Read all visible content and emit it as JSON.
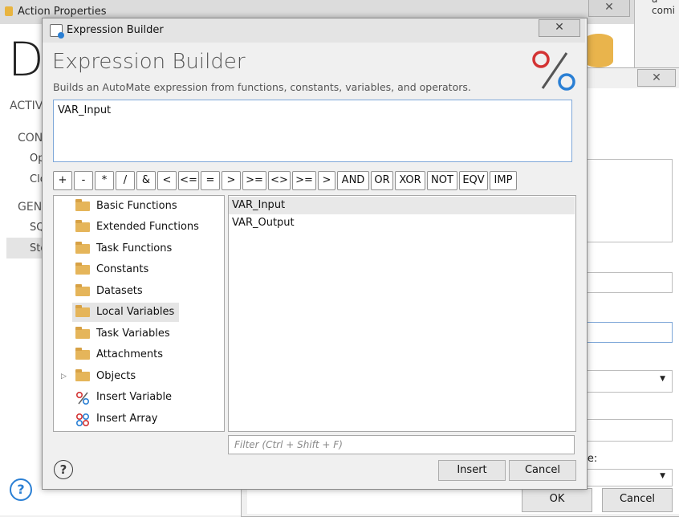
{
  "background_window": {
    "title": "Action Properties",
    "header_char": "Da",
    "left_items": [
      "ACTIV",
      "CON",
      "Op",
      "Clo",
      "GEN",
      "SQ",
      "Sto"
    ],
    "partial_label": "ble:",
    "ok_label": "OK",
    "cancel_label": "Cancel",
    "top_right_text": "a comi"
  },
  "dialog": {
    "title": "Expression Builder",
    "heading": "Expression Builder",
    "description": "Builds an AutoMate expression from functions, constants, variables, and operators.",
    "expression": "VAR_Input",
    "operators": [
      "+",
      "-",
      "*",
      "/",
      "&",
      "<",
      "<=",
      "=",
      ">",
      ">=",
      "<>",
      ">=",
      ">",
      "AND",
      "OR",
      "XOR",
      "NOT",
      "EQV",
      "IMP"
    ],
    "tree": [
      {
        "label": "Basic Functions",
        "icon": "folder-icon"
      },
      {
        "label": "Extended Functions",
        "icon": "folder-icon"
      },
      {
        "label": "Task Functions",
        "icon": "folder-icon"
      },
      {
        "label": "Constants",
        "icon": "folder-icon"
      },
      {
        "label": "Datasets",
        "icon": "folder-icon"
      },
      {
        "label": "Local Variables",
        "icon": "folder-icon",
        "selected": true
      },
      {
        "label": "Task Variables",
        "icon": "folder-icon"
      },
      {
        "label": "Attachments",
        "icon": "folder-icon"
      },
      {
        "label": "Objects",
        "icon": "folder-icon",
        "expandable": true
      },
      {
        "label": "Insert Variable",
        "icon": "insert-variable-icon"
      },
      {
        "label": "Insert Array",
        "icon": "insert-array-icon"
      }
    ],
    "variables": [
      {
        "label": "VAR_Input",
        "selected": true
      },
      {
        "label": "VAR_Output"
      }
    ],
    "filter_placeholder": "Filter (Ctrl + Shift + F)",
    "insert_label": "Insert",
    "cancel_label": "Cancel",
    "help_label": "?"
  },
  "colors": {
    "accent_blue": "#2a7fd4",
    "logo_red": "#d33333",
    "folder": "#e5b55a"
  }
}
